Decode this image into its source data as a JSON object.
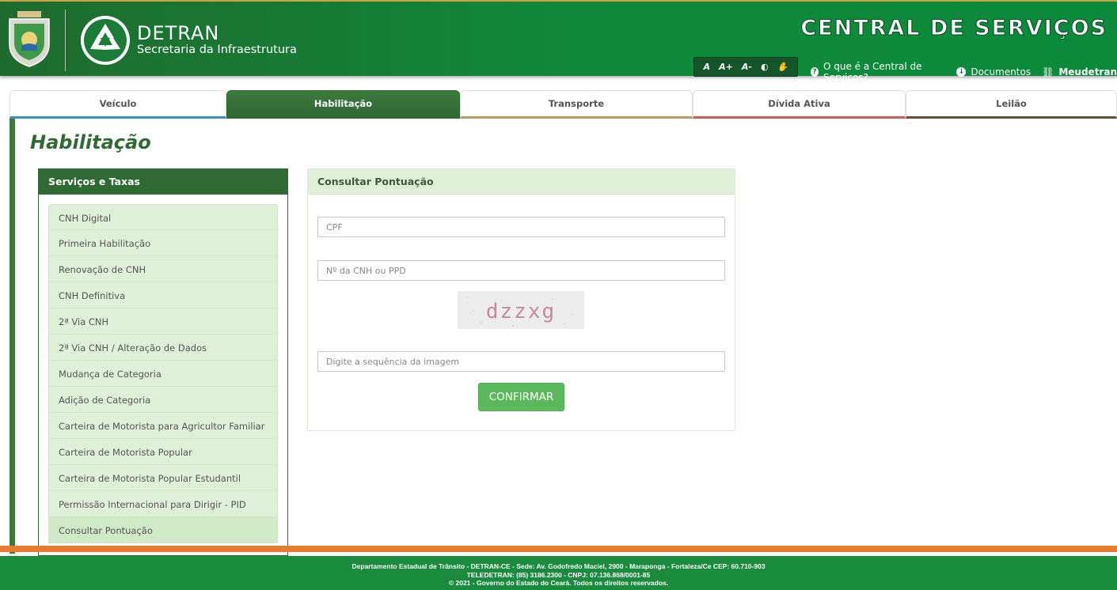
{
  "header": {
    "brand_name": "DETRAN",
    "brand_subtitle": "Secretaria da Infraestrutura",
    "central_title": "CENTRAL DE SERVIÇOS",
    "accessibility": [
      "A",
      "A+",
      "A-",
      "◐",
      "✋"
    ],
    "links": [
      {
        "icon": "question-icon",
        "label": "O que é a Central de Serviços?"
      },
      {
        "icon": "download-icon",
        "label": "Documentos"
      },
      {
        "icon": "link-icon",
        "label": "Meudetran"
      }
    ]
  },
  "tabs": [
    {
      "label": "Veículo"
    },
    {
      "label": "Habilitação"
    },
    {
      "label": "Transporte"
    },
    {
      "label": "Dívida Ativa"
    },
    {
      "label": "Leilão"
    }
  ],
  "page_title": "Habilitação",
  "services": {
    "title": "Serviços e Taxas",
    "items": [
      "CNH Digital",
      "Primeira Habilitação",
      "Renovação de CNH",
      "CNH Definitiva",
      "2ª Via CNH",
      "2ª Via CNH / Alteração de Dados",
      "Mudança de Categoria",
      "Adição de Categoria",
      "Carteira de Motorista para Agricultor Familiar",
      "Carteira de Motorista Popular",
      "Carteira de Motorista Popular Estudantil",
      "Permissão Internacional para Dirigir - PID",
      "Consultar Pontuação"
    ]
  },
  "form": {
    "title": "Consultar Pontuação",
    "cpf_placeholder": "CPF",
    "cnh_placeholder": "Nº da CNH ou PPD",
    "captcha_text": "dzzxg",
    "captcha_placeholder": "Digite a sequência da imagem",
    "submit_label": "CONFIRMAR"
  },
  "footer": {
    "line1": "Departamento Estadual de Trânsito - DETRAN-CE - Sede: Av. Godofredo Maciel, 2900 - Maraponga - Fortaleza/Ce CEP: 60.710-903",
    "line2": "TELEDETRAN: (85) 3186.2300 - CNPJ: 07.136.868/0001-85",
    "line3": "© 2021 - Governo do Estado do Ceará. Todos os direitos reservados."
  }
}
